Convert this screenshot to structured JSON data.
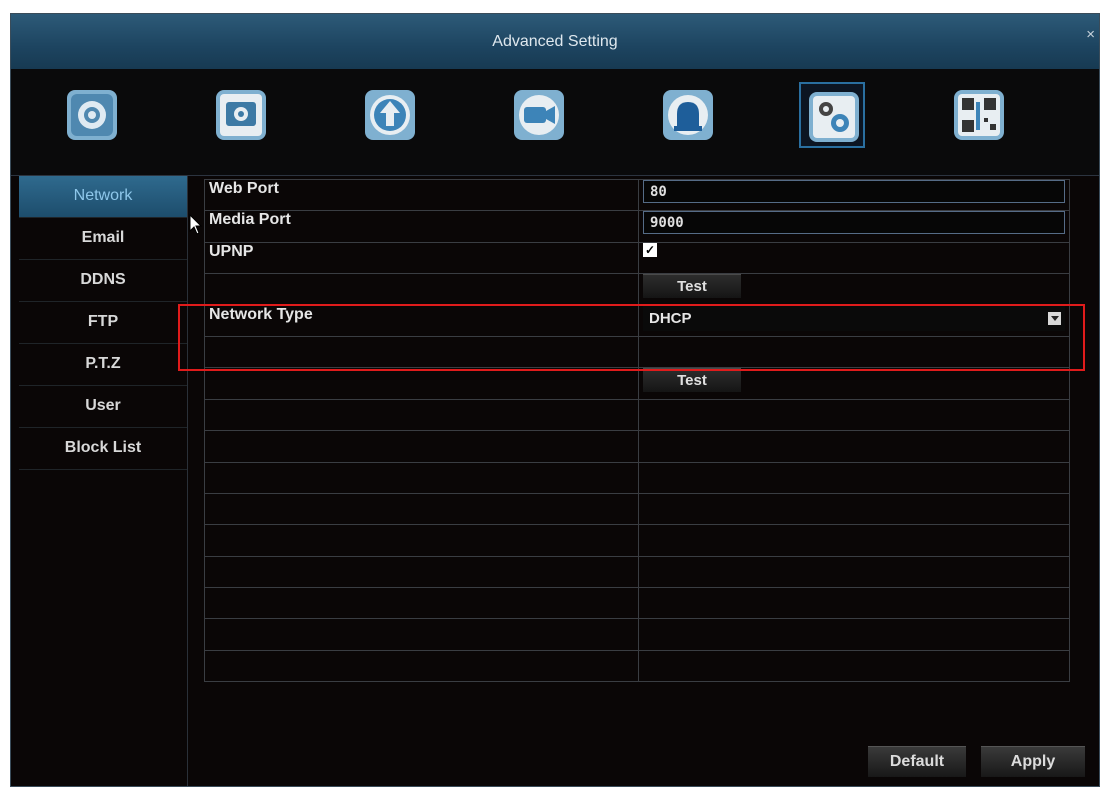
{
  "window": {
    "title": "Advanced Setting",
    "close_glyph": "×"
  },
  "toolbar": {
    "icons": [
      "general-settings-icon",
      "schedule-record-icon",
      "upgrade-icon",
      "camera-icon",
      "alarm-icon",
      "network-settings-icon",
      "info-icon"
    ],
    "active_index": 5
  },
  "sidebar": {
    "items": [
      {
        "label": "Network",
        "active": true
      },
      {
        "label": "Email"
      },
      {
        "label": "DDNS"
      },
      {
        "label": "FTP"
      },
      {
        "label": "P.T.Z"
      },
      {
        "label": "User"
      },
      {
        "label": "Block List"
      }
    ]
  },
  "network": {
    "web_port_label": "Web Port",
    "web_port_value": "80",
    "media_port_label": "Media Port",
    "media_port_value": "9000",
    "upnp_label": "UPNP",
    "upnp_checked_glyph": "✓",
    "test_label": "Test",
    "network_type_label": "Network Type",
    "network_type_value": "DHCP",
    "test2_label": "Test"
  },
  "footer": {
    "default_label": "Default",
    "apply_label": "Apply"
  },
  "colors": {
    "highlight": "#e01b1b",
    "title_bar": "#1d4460",
    "active_tab": "#2f6a8e"
  }
}
